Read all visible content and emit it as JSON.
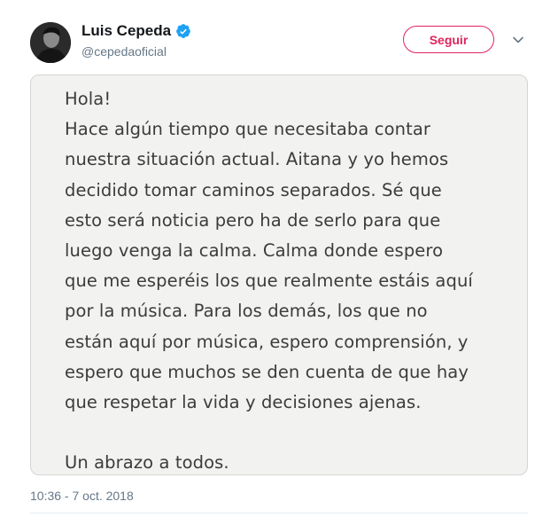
{
  "author": {
    "display_name": "Luis Cepeda",
    "handle": "@cepedaoficial",
    "verified": true
  },
  "follow_button": {
    "label": "Seguir"
  },
  "media_note": {
    "lines": [
      "Hola!",
      "Hace algún tiempo que necesitaba contar",
      "nuestra situación actual. Aitana y yo hemos",
      "decidido tomar caminos separados. Sé que",
      "esto será noticia pero ha de serlo para que",
      "luego venga la calma. Calma donde espero",
      "que me esperéis los que realmente estáis aquí",
      "por la música. Para los demás, los que no",
      "están aquí por música, espero comprensión, y",
      "espero que muchos se den cuenta de que hay",
      "que respetar la vida y decisiones ajenas.",
      "",
      "Un abrazo a todos."
    ]
  },
  "timestamp": "10:36 - 7 oct. 2018",
  "colors": {
    "accent": "#e0245e",
    "verified_blue": "#1da1f2",
    "secondary_text": "#657786"
  },
  "icons": {
    "verified": "verified-badge-icon",
    "menu": "chevron-down-icon"
  }
}
